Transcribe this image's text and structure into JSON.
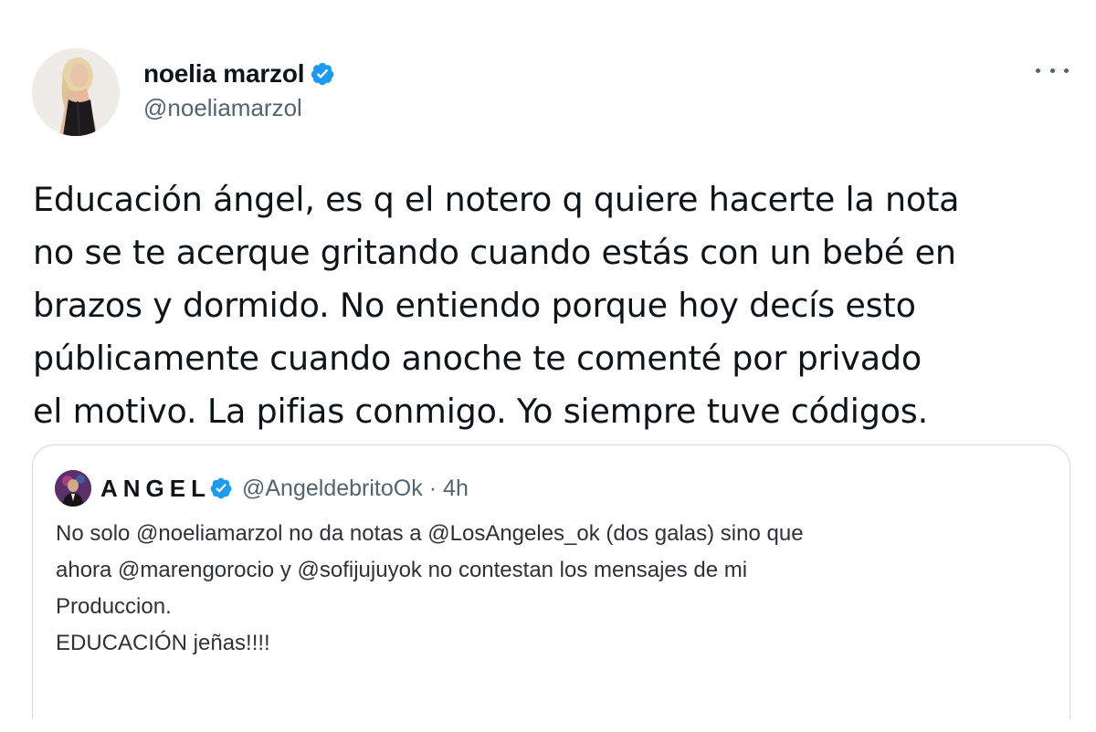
{
  "tweet": {
    "author": {
      "name": "noelia marzol",
      "handle": "@noeliamarzol"
    },
    "text": "Educación ángel, es q el notero q quiere hacerte la nota\nno se te acerque gritando cuando estás con un bebé en\nbrazos y dormido. No entiendo porque hoy decís esto\npúblicamente cuando anoche te comenté por privado\nel motivo. La pifias conmigo. Yo siempre tuve códigos.",
    "more_icon": "more-horizontal-icon",
    "verified_icon": "verified-badge-icon"
  },
  "quoted_tweet": {
    "author": {
      "name": "ANGEL",
      "handle": "@AngeldebritoOk"
    },
    "separator": "·",
    "time": "4h",
    "text": "No solo @noeliamarzol no da notas a @LosAngeles_ok (dos galas) sino que\nahora @marengorocio y @sofijujuyok no contestan los mensajes de mi\nProduccion.\nEDUCACIÓN jeñas!!!!"
  },
  "colors": {
    "text_primary": "#0f1419",
    "text_secondary": "#536471",
    "verified_blue": "#1d9bf0",
    "border": "#cfd9de"
  }
}
